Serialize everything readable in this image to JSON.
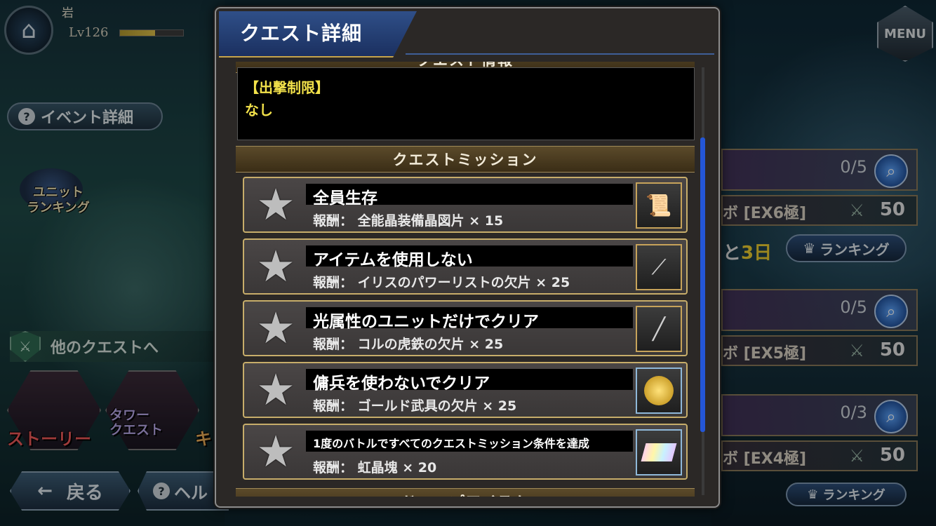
{
  "player": {
    "name": "岩",
    "level": "Lv126",
    "exp_fraction": 0.55
  },
  "left_menu": {
    "event_details": "イベント詳細",
    "unit_ranking": "ユニット\nランキング",
    "other_quests": "他のクエストへ",
    "story": "ストーリー",
    "tower_quest": "タワー\nクエスト",
    "third_tile_partial": "キ",
    "back": "戻る",
    "help_partial": "ヘル"
  },
  "right_panel": {
    "menu": "MENU",
    "cards": [
      {
        "progress": "0/5",
        "difficulty": "ボ [EX6極]",
        "stamina": "50"
      },
      {
        "progress": "0/5",
        "difficulty": "ボ [EX5極]",
        "stamina": "50"
      },
      {
        "progress": "0/3",
        "difficulty": "ボ [EX4極]",
        "stamina": "50"
      }
    ],
    "days_left_prefix": "と",
    "days_left_value": "3日",
    "ranking": "ランキング",
    "ranking_bottom_partial": "ランキング"
  },
  "modal": {
    "title": "クエスト詳細",
    "partial_top_section": "クエスト情報",
    "restriction_title": "【出撃制限】",
    "restriction_value": "なし",
    "missions_header": "クエストミッション",
    "missions": [
      {
        "name": "全員生存",
        "reward": "報酬： 全能晶装備晶図片 × 15",
        "reward_icon": "scroll-icon"
      },
      {
        "name": "アイテムを使用しない",
        "reward": "報酬： イリスのパワーリストの欠片 × 25",
        "reward_icon": "bracelet-icon"
      },
      {
        "name": "光属性のユニットだけでクリア",
        "reward": "報酬： コルの虎鉄の欠片 × 25",
        "reward_icon": "sword-icon"
      },
      {
        "name": "傭兵を使わないでクリア",
        "reward": "報酬： ゴールド武具の欠片 × 25",
        "reward_icon": "gold-coin-icon"
      },
      {
        "name": "1度のバトルですべてのクエストミッション条件を達成",
        "reward": "報酬： 虹晶塊 × 20",
        "reward_icon": "rainbow-crystal-icon"
      }
    ],
    "partial_bottom_section": "ドロップアイテム"
  },
  "colors": {
    "accent_blue": "#2456d6",
    "gold_border": "#c7ad6a",
    "restriction_text": "#f2e14a"
  }
}
